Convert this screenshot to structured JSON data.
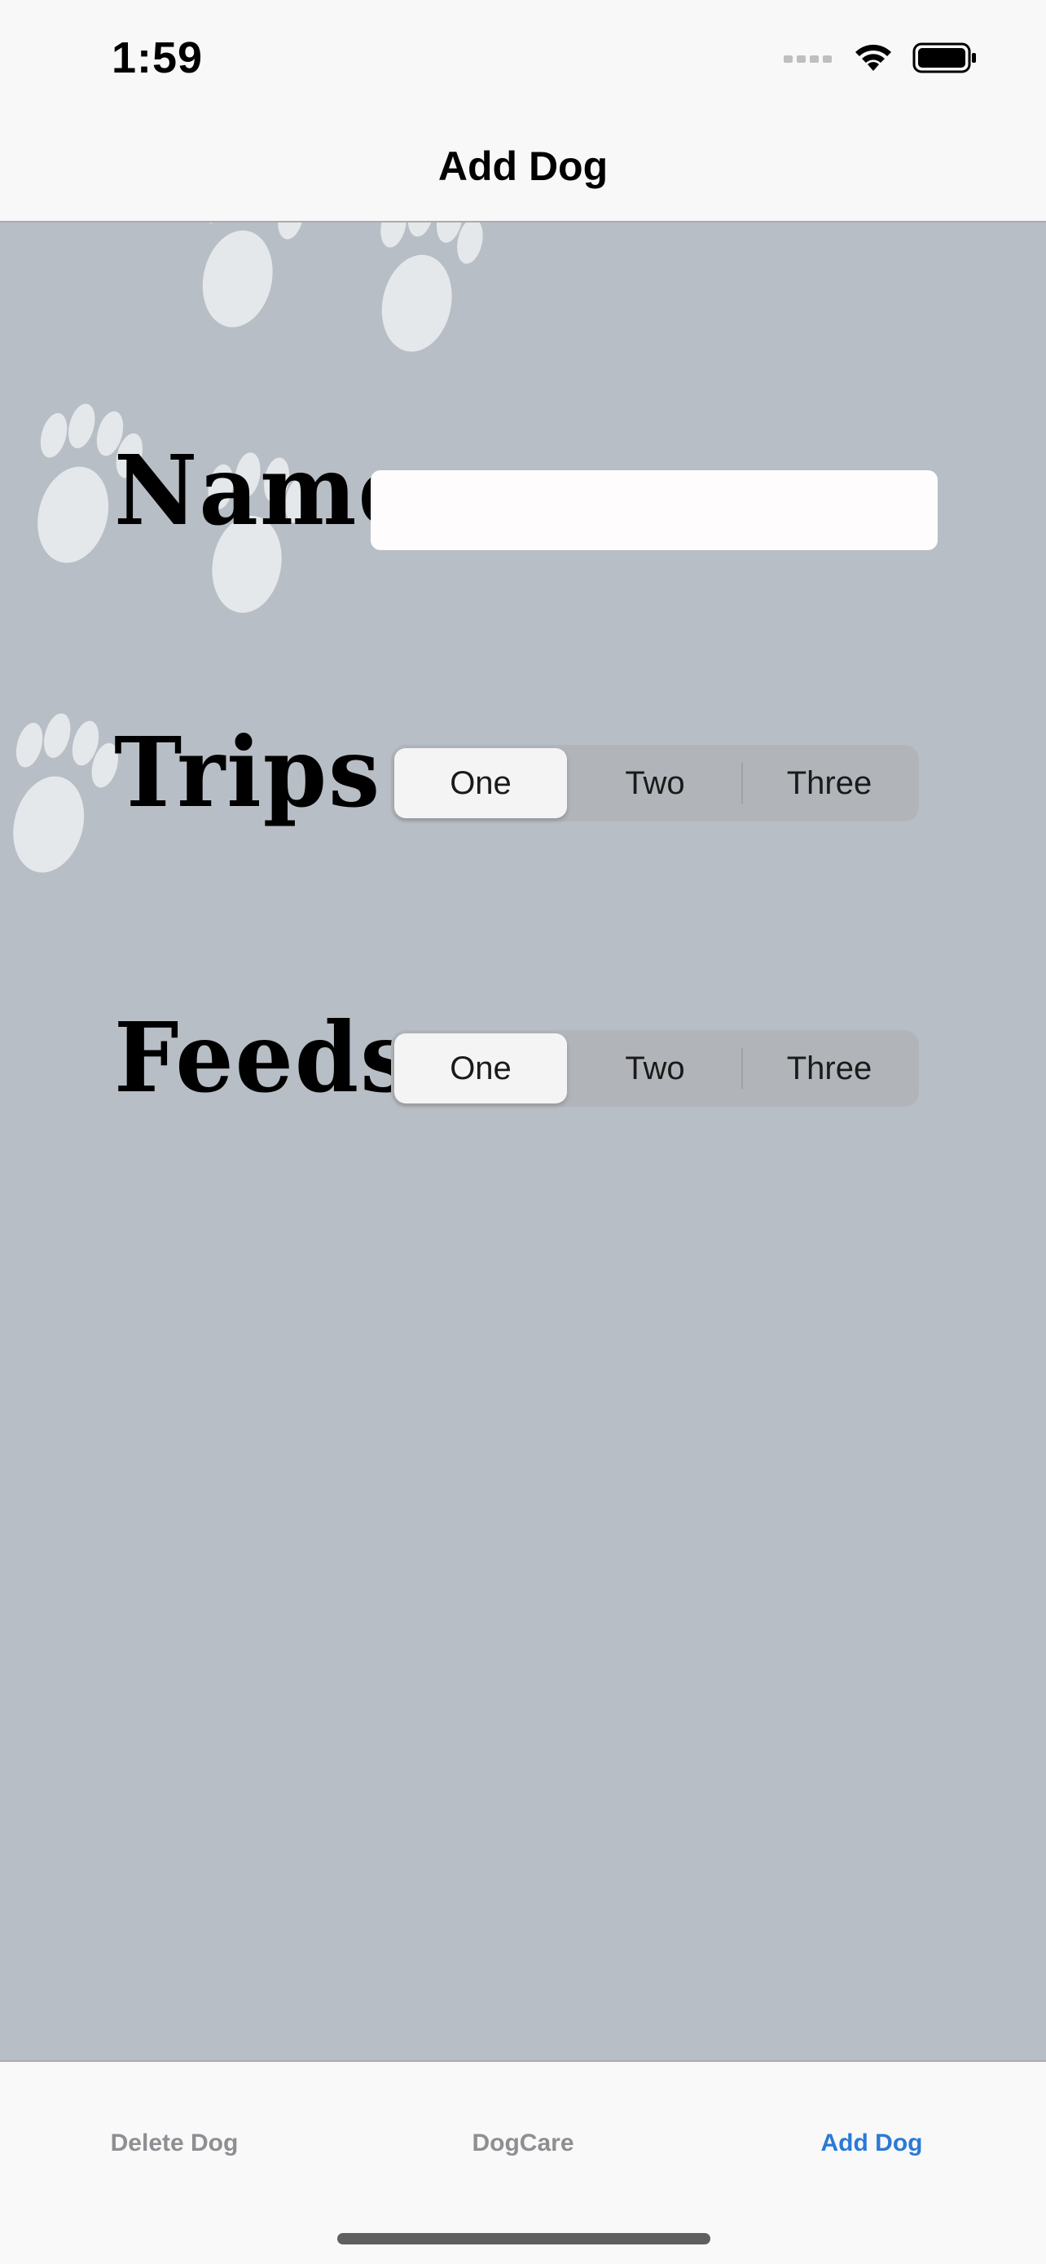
{
  "status_bar": {
    "time": "1:59",
    "icons": [
      "cellular-signal-icon",
      "wifi-icon",
      "battery-icon"
    ]
  },
  "nav": {
    "title": "Add Dog"
  },
  "form": {
    "name_label": "Name",
    "name_value": "",
    "trips_label": "Trips",
    "trips_options": [
      "One",
      "Two",
      "Three"
    ],
    "trips_selected": "One",
    "feeds_label": "Feeds",
    "feeds_options": [
      "One",
      "Two",
      "Three"
    ],
    "feeds_selected": "One"
  },
  "tab_bar": {
    "items": [
      {
        "label": "Delete Dog",
        "active": false
      },
      {
        "label": "DogCare",
        "active": false
      },
      {
        "label": "Add Dog",
        "active": true
      }
    ]
  },
  "colors": {
    "background": "#b8bec5",
    "bars": "#f8f8f8",
    "accent": "#2a7ad6",
    "inactive_tab": "#8e8e93",
    "paw": "#e4e8eb"
  }
}
